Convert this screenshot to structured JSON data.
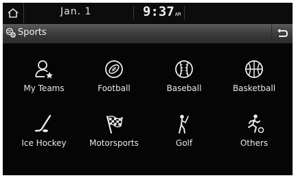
{
  "status": {
    "date": "Jan.  1",
    "time": "9:37",
    "ampm": "AM"
  },
  "header": {
    "title": "Sports"
  },
  "categories": [
    {
      "label": "My Teams",
      "icon": "person-star-icon"
    },
    {
      "label": "Football",
      "icon": "football-icon"
    },
    {
      "label": "Baseball",
      "icon": "baseball-icon"
    },
    {
      "label": "Basketball",
      "icon": "basketball-icon"
    },
    {
      "label": "Ice Hockey",
      "icon": "hockey-stick-icon"
    },
    {
      "label": "Motorsports",
      "icon": "checkered-flag-icon"
    },
    {
      "label": "Golf",
      "icon": "golfer-icon"
    },
    {
      "label": "Others",
      "icon": "runner-icon"
    }
  ],
  "colors": {
    "background": "#050505",
    "text": "#eaeaea",
    "titlebar": "#4a4a4a"
  }
}
